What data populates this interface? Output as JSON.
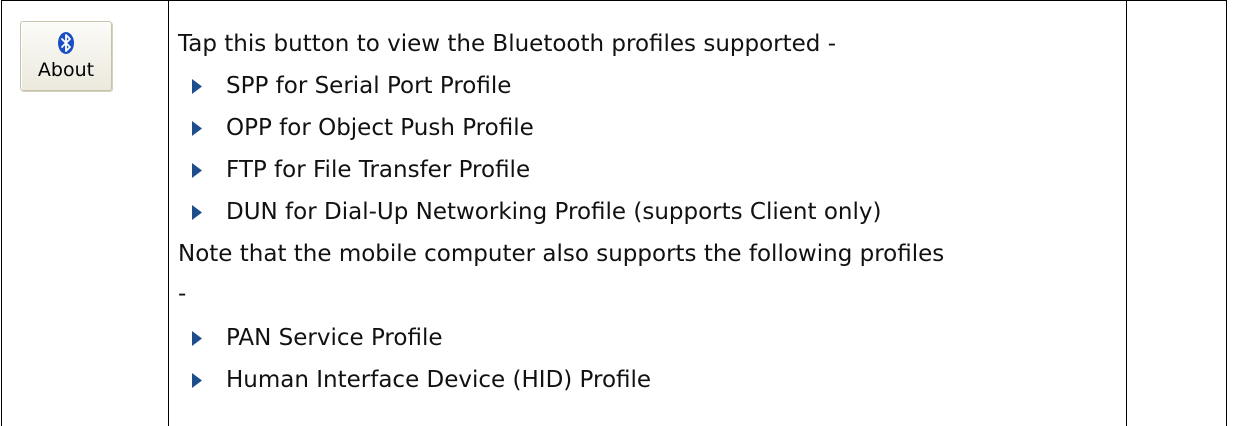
{
  "about_button": {
    "label": "About",
    "icon": "bluetooth-icon"
  },
  "intro": "Tap this button to view the Bluetooth profiles supported -",
  "supported_profiles": [
    "SPP for Serial Port Profile",
    "OPP for Object Push Profile",
    "FTP for File Transfer Profile",
    "DUN for Dial-Up Networking Profile (supports Client only)"
  ],
  "note_line1": "Note that the mobile computer also supports the following profiles",
  "note_line2": "-",
  "additional_profiles": [
    "PAN Service Profile",
    "Human Interface Device (HID) Profile"
  ],
  "colors": {
    "bullet": "#1f4e8c",
    "bluetooth_blue": "#1a4fc4"
  }
}
